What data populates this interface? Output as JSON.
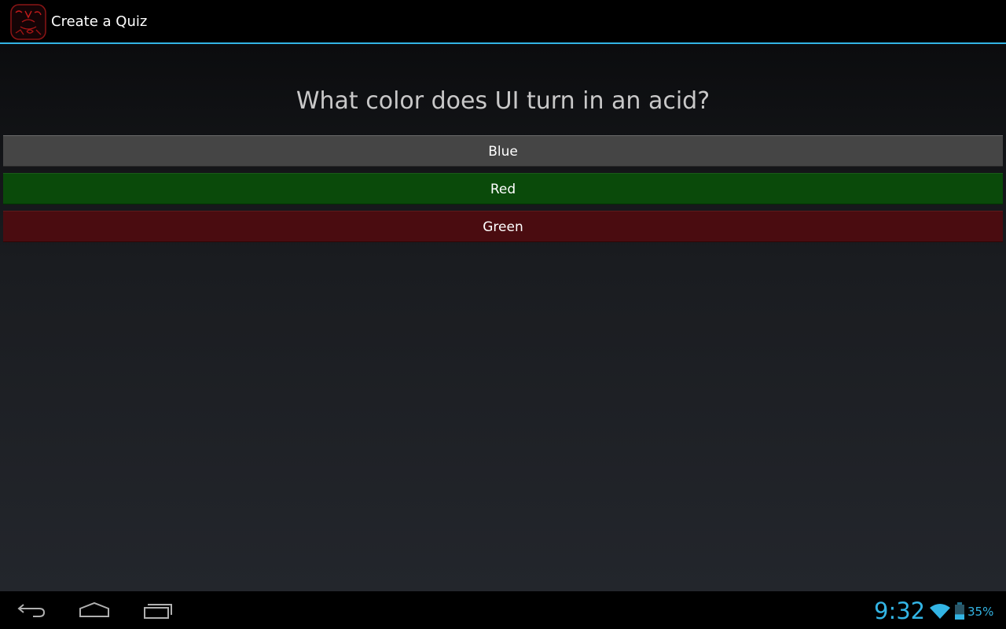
{
  "action_bar": {
    "title": "Create a Quiz",
    "icon": "create-a-quiz-logo-icon",
    "accent_color": "#33b5e5"
  },
  "quiz": {
    "question": "What color does UI turn in an acid?",
    "answers": [
      {
        "label": "Blue",
        "color": "#454545"
      },
      {
        "label": "Red",
        "color": "#0a4a0a"
      },
      {
        "label": "Green",
        "color": "#4a0c10"
      }
    ]
  },
  "nav_bar": {
    "buttons": [
      "back-icon",
      "home-icon",
      "recent-apps-icon"
    ]
  },
  "status": {
    "time": "9:32",
    "battery_percent": "35%",
    "battery_level": 0.35,
    "wifi_icon": "wifi-icon",
    "battery_icon": "battery-icon",
    "color": "#33b5e5"
  }
}
